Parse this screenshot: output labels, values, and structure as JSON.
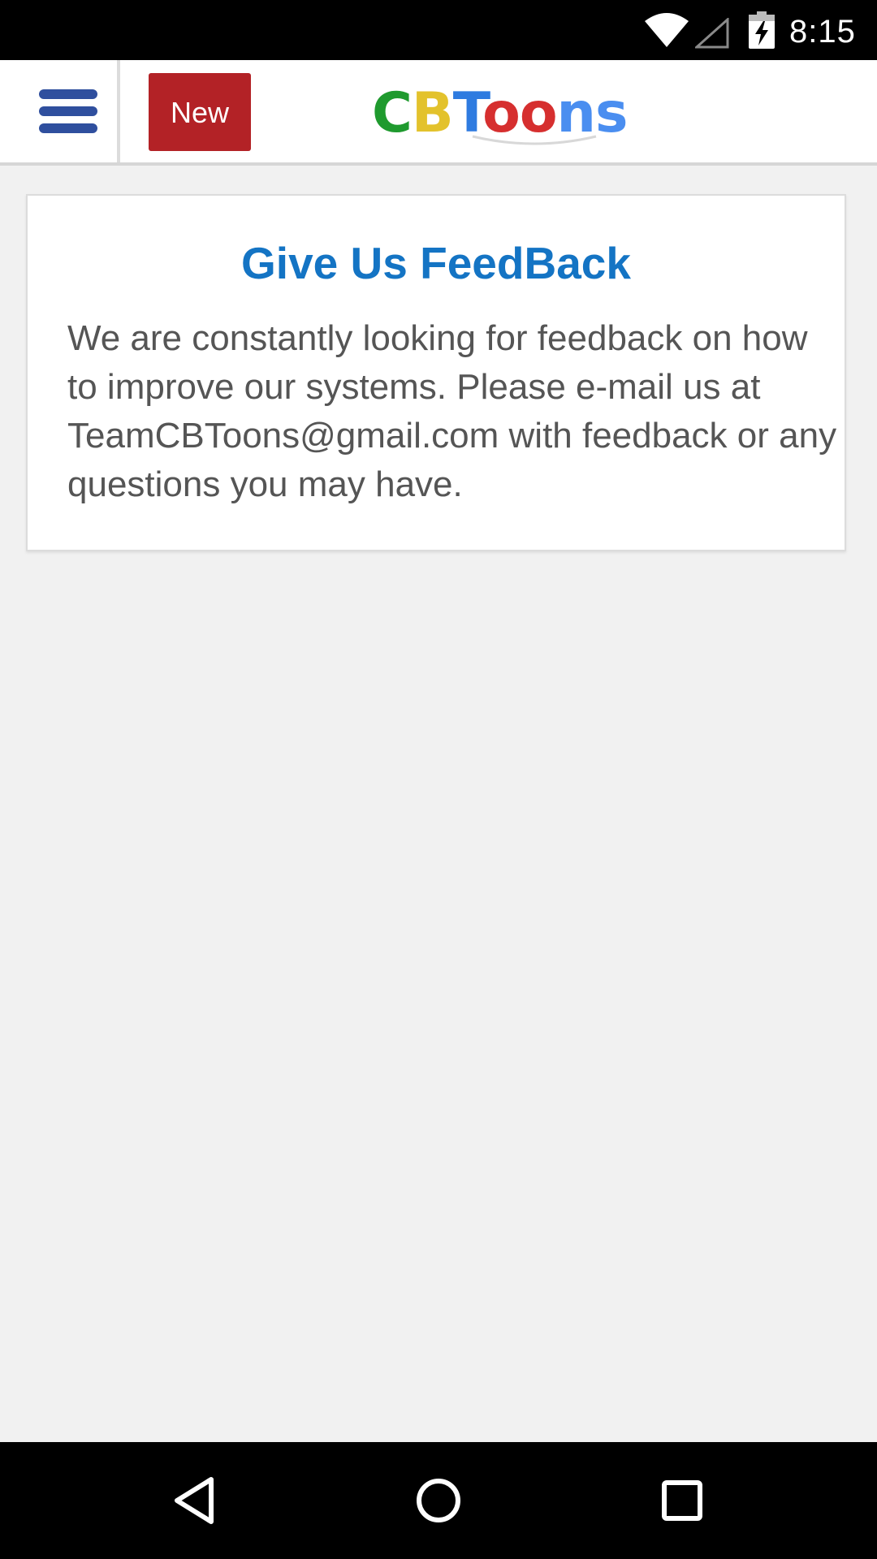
{
  "status_bar": {
    "time": "8:15",
    "icons": [
      "wifi-icon",
      "signal-icon",
      "battery-charging-icon"
    ]
  },
  "header": {
    "menu_icon": "hamburger-menu-icon",
    "new_button_label": "New",
    "logo": {
      "text": "CBToons",
      "letters": [
        {
          "char": "C",
          "color": "#1f9a2e"
        },
        {
          "char": "B",
          "color": "#e3c22c"
        },
        {
          "char": "T",
          "color": "#2e7be0"
        },
        {
          "char": "o",
          "color": "#d62f2f"
        },
        {
          "char": "o",
          "color": "#d62f2f"
        },
        {
          "char": "n",
          "color": "#4a8ef0"
        },
        {
          "char": "s",
          "color": "#4a8ef0"
        }
      ]
    }
  },
  "feedback": {
    "title": "Give Us FeedBack",
    "body": "We are constantly looking for feedback on how to improve our systems. Please e-mail us at TeamCBToons@gmail.com with feedback or any questions you may have."
  },
  "nav_bar": {
    "buttons": [
      "back-icon",
      "home-icon",
      "recents-icon"
    ]
  },
  "colors": {
    "menu_icon": "#2f4f9e",
    "new_button_bg": "#b32226",
    "title": "#1474c4",
    "body_text": "#555555",
    "page_bg": "#f1f1f1"
  }
}
